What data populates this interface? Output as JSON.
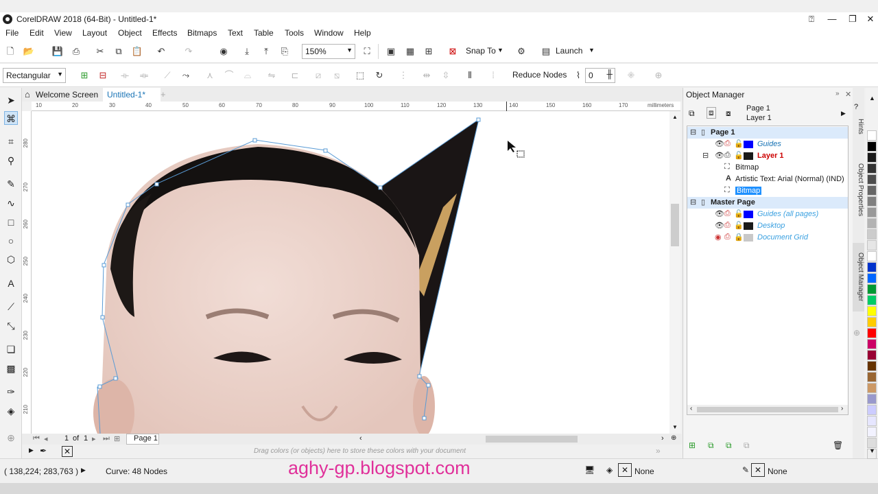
{
  "app": {
    "title": "CorelDRAW 2018 (64-Bit) - Untitled-1*"
  },
  "menu": [
    "File",
    "Edit",
    "View",
    "Layout",
    "Object",
    "Effects",
    "Bitmaps",
    "Text",
    "Table",
    "Tools",
    "Window",
    "Help"
  ],
  "toolbar": {
    "zoom": "150%",
    "snap_label": "Snap To",
    "launch_label": "Launch"
  },
  "propertybar": {
    "shape_mode": "Rectangular",
    "reduce_nodes": "Reduce Nodes",
    "smoothing_value": "0"
  },
  "tabs": {
    "welcome": "Welcome Screen",
    "document": "Untitled-1*"
  },
  "ruler": {
    "unit": "millimeters",
    "h_ticks": [
      "10",
      "20",
      "30",
      "40",
      "50",
      "60",
      "70",
      "80",
      "90",
      "100",
      "110",
      "120",
      "130",
      "140",
      "150",
      "160",
      "170"
    ],
    "v_ticks": [
      "280",
      "270",
      "260",
      "250",
      "240",
      "230",
      "220",
      "210"
    ]
  },
  "pager": {
    "current": "1",
    "of": "of",
    "total": "1",
    "page_tab": "Page 1"
  },
  "palette_hint": "Drag colors (or objects) here to store these colors with your document",
  "status": {
    "coords": "( 138,224; 283,763 )",
    "info": "Curve: 48 Nodes",
    "watermark": "aghy-gp.blogspot.com",
    "fill": "None",
    "outline": "None"
  },
  "object_manager": {
    "title": "Object Manager",
    "page_label": "Page 1",
    "layer_label": "Layer 1",
    "rows": [
      {
        "text": "Page 1",
        "color": ""
      },
      {
        "text": "Guides",
        "color": "#0000ff"
      },
      {
        "text": "Layer 1",
        "color": "#1a1a1a"
      },
      {
        "text": "Bitmap",
        "color": ""
      },
      {
        "text": "Artistic Text: Arial (Normal) (IND)",
        "color": ""
      },
      {
        "text": "Bitmap",
        "color": ""
      },
      {
        "text": "Master Page",
        "color": ""
      },
      {
        "text": "Guides (all pages)",
        "color": "#0000ff"
      },
      {
        "text": "Desktop",
        "color": "#1a1a1a"
      },
      {
        "text": "Document Grid",
        "color": "#c8c8c8"
      }
    ]
  },
  "dockers": [
    "Hints",
    "Object Properties",
    "Object Manager"
  ],
  "palette_colors": [
    "#ffffff",
    "#000000",
    "#1a1a1a",
    "#333333",
    "#4d4d4d",
    "#666666",
    "#808080",
    "#999999",
    "#b3b3b3",
    "#cccccc",
    "#e6e6e6",
    "#ffffff",
    "#0033cc",
    "#0066ff",
    "#009933",
    "#00cc66",
    "#ffff00",
    "#ffcc00",
    "#ff0000",
    "#cc0066",
    "#990033",
    "#663300",
    "#996633",
    "#cc9966",
    "#9999cc",
    "#ccccff",
    "#e6e6ff",
    "#f2f2ff",
    "#dddddd",
    "#eeeeee"
  ]
}
